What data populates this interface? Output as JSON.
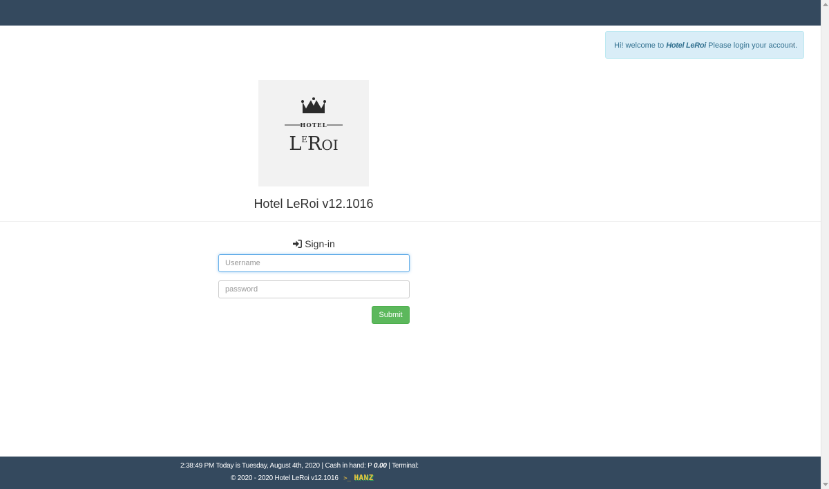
{
  "alert": {
    "prefix": "Hi! welcome to",
    "hotel_name": "Hotel LeRoi",
    "suffix": "Please login your account.",
    "close": "×"
  },
  "logo": {
    "small_word": "HOTEL",
    "large_word": "LEROI"
  },
  "app_title": "Hotel LeRoi v12.1016",
  "login": {
    "heading": "Sign-in",
    "username_placeholder": "Username",
    "password_placeholder": "password",
    "submit_label": "Submit"
  },
  "footer": {
    "time": "2:38:49 PM",
    "today_text": "Today is Tuesday, August 4th, 2020",
    "cash_label": "| Cash in hand: P",
    "cash_value": "0.00",
    "terminal_label": "| Terminal:",
    "copyright": "© 2020 - 2020 Hotel LeRoi v12.1016",
    "prompt": ">_",
    "brand": "HANZ"
  },
  "colors": {
    "nav": "#34495e",
    "alert_bg": "#d9edf7",
    "alert_text": "#31708f",
    "submit": "#5cb85c",
    "focus": "#66afe9"
  },
  "icons": {
    "logo": "crown-icon",
    "signin": "sign-in-icon",
    "close": "close-icon"
  }
}
